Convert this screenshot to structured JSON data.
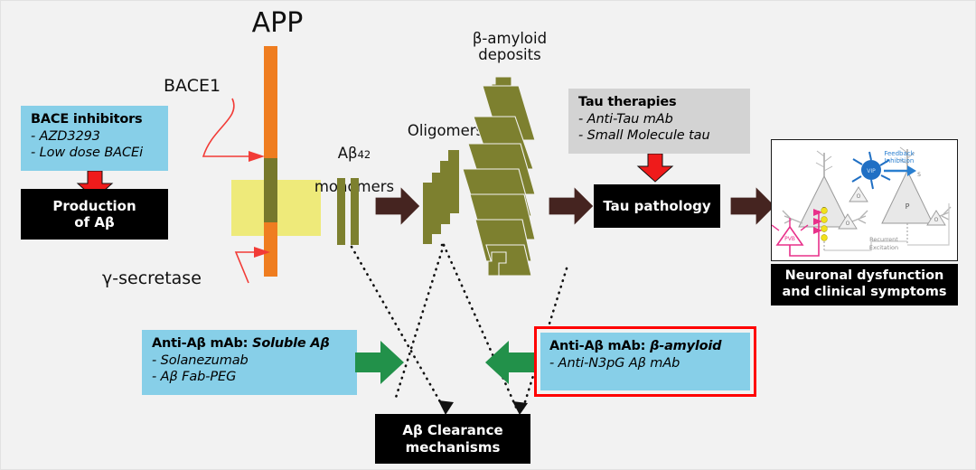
{
  "figure": {
    "title_app": "APP",
    "label_bace1": "BACE1",
    "label_gamma_secretase": "γ-secretase",
    "label_monomers": "Aβ₄₂\nmonomers",
    "label_monomers_main": "Aβ",
    "label_monomers_sub": "42",
    "label_monomers_line2": "monomers",
    "label_oligomers": "Oligomers",
    "label_deposits": "β-amyloid\ndeposits"
  },
  "boxes": {
    "bace_inhibitors": {
      "title": "BACE inhibitors",
      "items": [
        "- AZD3293",
        "- Low dose BACEi"
      ]
    },
    "tau_therapies": {
      "title": "Tau therapies",
      "items": [
        "- Anti-Tau mAb",
        "- Small Molecule tau"
      ]
    },
    "anti_ab_soluble": {
      "title_plain": "Anti-Aβ mAb: ",
      "title_italic": "Soluble Aβ",
      "items": [
        "-  Solanezumab",
        "-  Aβ Fab-PEG"
      ]
    },
    "anti_ab_amyloid": {
      "title_plain": "Anti-Aβ mAb: ",
      "title_italic": "β-amyloid",
      "items": [
        "- Anti-N3pG Aβ mAb"
      ]
    }
  },
  "outcomes": {
    "production": "Production\nof Aβ",
    "tau_pathology": "Tau pathology",
    "neuronal": "Neuronal dysfunction\nand clinical symptoms",
    "clearance": "Aβ Clearance\nmechanisms"
  },
  "neuron_panel": {
    "feedback_inhibition": "Feedback\nInhibition",
    "recurrent_excitation": "Recurrent\nExcitation",
    "cell_pyramidal": "P",
    "cell_pvb": "PVB",
    "cell_vip": "VIP",
    "cell_sst": "S",
    "cell_other": "O"
  },
  "colors": {
    "background": "#f2f2f2",
    "blue_box": "#87cfe8",
    "grey_box": "#d3d3d3",
    "black_box": "#000000",
    "red_arrow": "#ef1b1b",
    "red_frame": "#ff0000",
    "green_arrow": "#22914a",
    "brown_arrow": "#452420",
    "olive": "#7d802f",
    "app_orange": "#ef7d20",
    "app_olive": "#76782c",
    "membrane_yellow": "#eeea7a",
    "pointer_red": "#f23b36"
  }
}
